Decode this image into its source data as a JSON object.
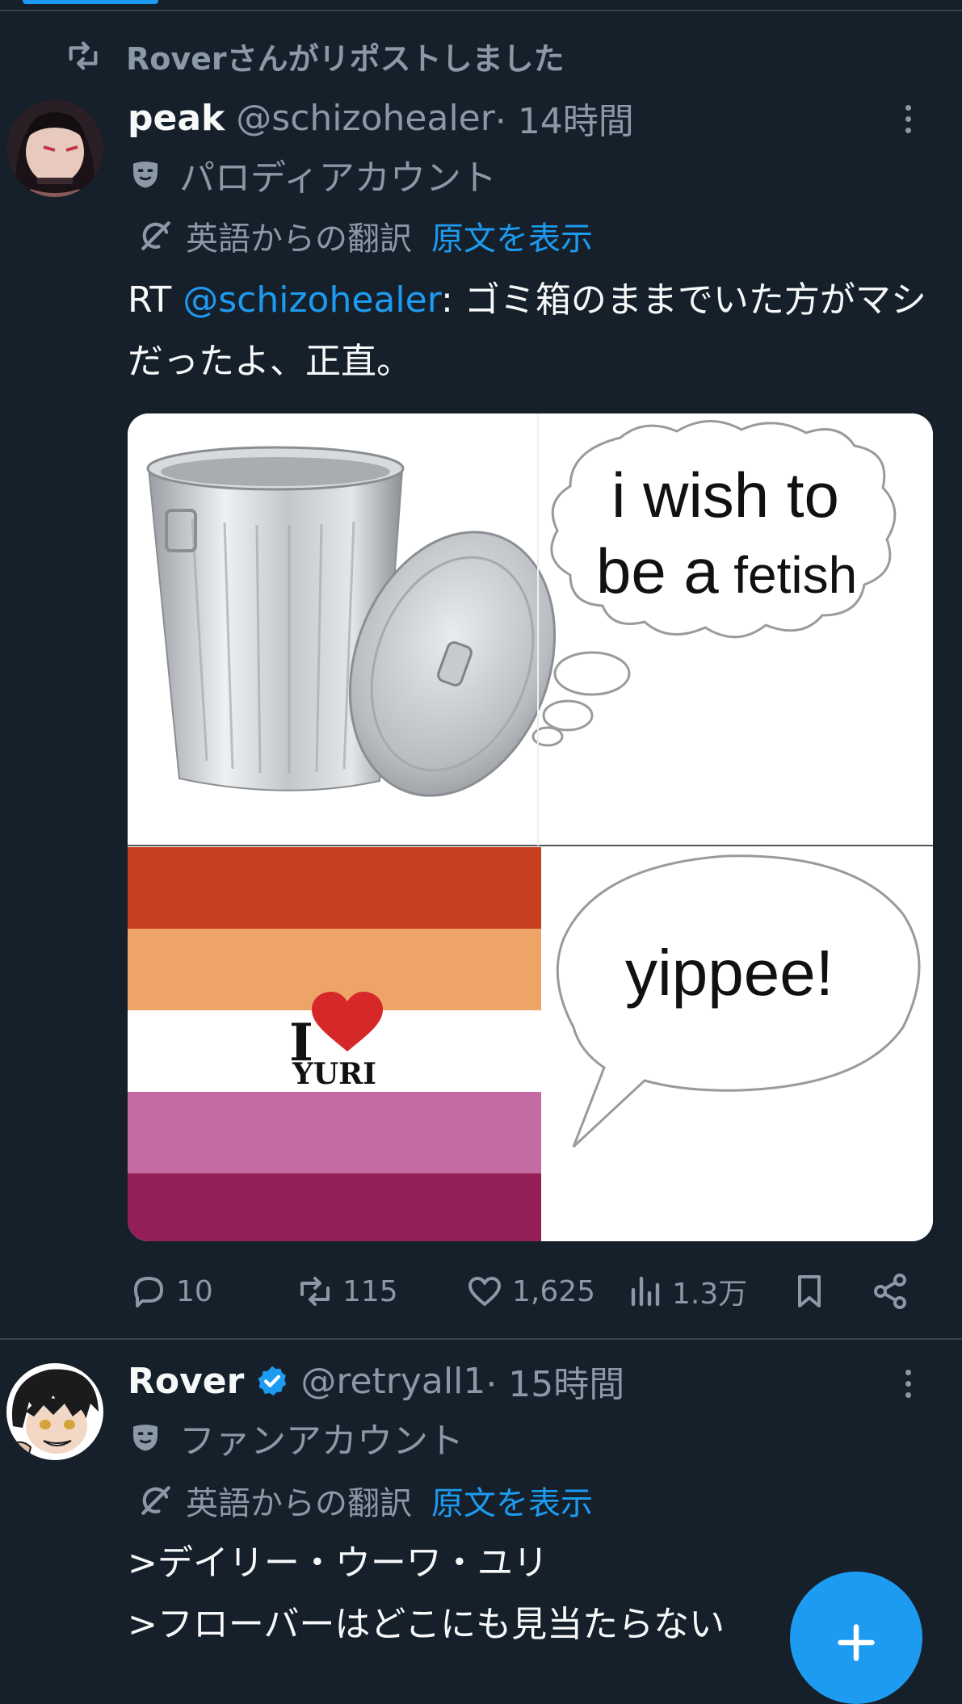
{
  "repost_banner": {
    "text": "Roverさんがリポストしました",
    "icon": "repost-icon"
  },
  "tweets": [
    {
      "display_name": "peak",
      "handle": "@schizohealer",
      "time": " · 14時間",
      "account_label": "パロディアカウント",
      "translation_note": "英語からの翻訳",
      "show_original": "原文を表示",
      "text_prefix": "RT ",
      "mention": "@schizohealer",
      "text_body": ": ゴミ箱のままでいた方がマシだったよ、正直。",
      "media": {
        "bubble1_line1": "i wish to",
        "bubble1_line2": "be a",
        "bubble1_line2b": "fetish",
        "bubble2": "yippee!",
        "flag_i": "I",
        "flag_yuri": "YURI"
      },
      "stats": {
        "replies": "10",
        "reposts": "115",
        "likes": "1,625",
        "views": "1.3万"
      }
    },
    {
      "display_name": "Rover",
      "handle": "@retryall1",
      "time": " · 15時間",
      "account_label": "ファンアカウント",
      "translation_note": "英語からの翻訳",
      "show_original": "原文を表示",
      "line1": ">デイリー・ウーワ・ユリ",
      "line2": ">フローバーはどこにも見当たらない",
      "verified": true
    }
  ],
  "colors": {
    "background": "#15202b",
    "accent": "#1d9bf0",
    "muted": "#8b98a5",
    "divider": "#38444d"
  },
  "fab": {
    "icon": "plus-icon"
  }
}
